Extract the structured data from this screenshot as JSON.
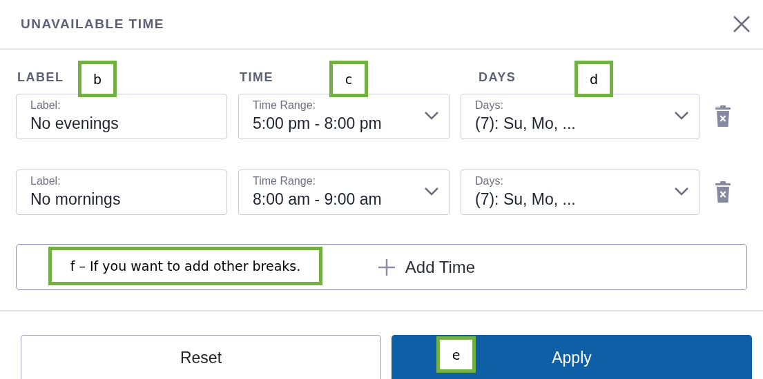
{
  "dialog": {
    "title": "UNAVAILABLE TIME"
  },
  "columns": [
    "LABEL",
    "TIME",
    "DAYS"
  ],
  "rows": [
    {
      "label": {
        "caption": "Label:",
        "value": "No evenings"
      },
      "time": {
        "caption": "Time Range:",
        "value": "5:00 pm - 8:00 pm"
      },
      "days": {
        "caption": "Days:",
        "value": "(7): Su, Mo, ..."
      }
    },
    {
      "label": {
        "caption": "Label:",
        "value": "No mornings"
      },
      "time": {
        "caption": "Time Range:",
        "value": "8:00 am - 9:00 am"
      },
      "days": {
        "caption": "Days:",
        "value": "(7): Su, Mo, ..."
      }
    }
  ],
  "add_button": "Add Time",
  "buttons": [
    {
      "label": "Reset",
      "kind": "secondary"
    },
    {
      "label": "Apply",
      "kind": "primary"
    }
  ],
  "annotations": [
    "b",
    "c",
    "d",
    "f – If you want to add other breaks.",
    "e"
  ]
}
